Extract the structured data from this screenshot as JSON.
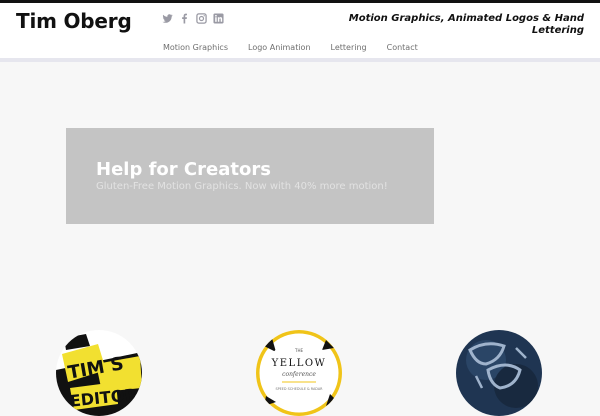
{
  "site": {
    "title": "Tim Oberg",
    "tagline": "Motion Graphics, Animated Logos & Hand Lettering"
  },
  "social": [
    {
      "icon": "twitter-icon",
      "label": "Twitter"
    },
    {
      "icon": "facebook-icon",
      "label": "Facebook"
    },
    {
      "icon": "instagram-icon",
      "label": "Instagram"
    },
    {
      "icon": "linkedin-icon",
      "label": "LinkedIn"
    }
  ],
  "nav": {
    "items": [
      "Motion Graphics",
      "Logo Animation",
      "Lettering",
      "Contact"
    ]
  },
  "hero": {
    "title": "Help for Creators",
    "subtitle": "Gluten-Free Motion Graphics. Now with 40% more motion!"
  },
  "portfolio": {
    "items": [
      {
        "icon": "tims-editor-lettering-thumbnail",
        "accent": "#f2e030"
      },
      {
        "icon": "yellow-conference-logo-thumbnail",
        "lines": [
          "THE",
          "YELLOW",
          "conference",
          "SPEED SCHEDULE & RADAR"
        ]
      },
      {
        "icon": "hand-lettering-stamp-thumbnail",
        "accent": "#1f3552"
      }
    ]
  },
  "colors": {
    "header_bg": "#ffffff",
    "page_bg": "#f7f7f7",
    "hero_bg": "#c4c4c4",
    "nav_text": "#6f6f6f"
  }
}
